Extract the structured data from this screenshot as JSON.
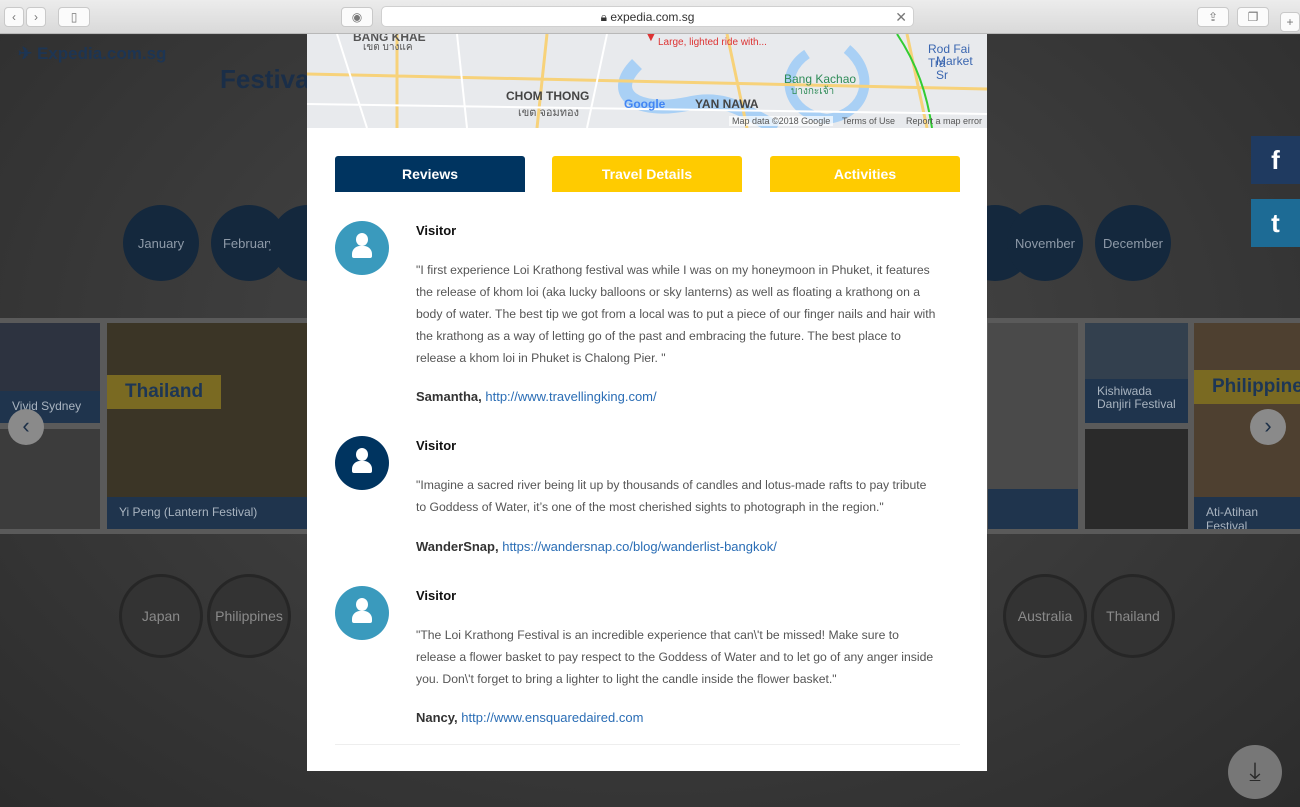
{
  "browser": {
    "url": "expedia.com.sg",
    "back": "‹",
    "forward": "›"
  },
  "site": {
    "logo": "Expedia.com.sg",
    "title": "Festiva"
  },
  "months": [
    "January",
    "February",
    "November",
    "December"
  ],
  "countries": [
    "Japan",
    "Philippines",
    "Australia",
    "Thailand"
  ],
  "gallery": {
    "tiles": [
      {
        "caption": "Vivid Sydney"
      },
      {
        "caption": "Yi Peng (Lantern Festival)",
        "tag": "Thailand"
      },
      {
        "caption": "Kishiwada Danjiri Festival"
      },
      {
        "caption": "Ati-Atihan Festival",
        "tag": "Philippine"
      }
    ]
  },
  "social": {
    "facebook": "f",
    "twitter": "t"
  },
  "map": {
    "labels": [
      "BANG KHAE",
      "เขต บางแค",
      "CHOM THONG",
      "เขต จอมทอง",
      "YAN NAWA",
      "Bang Kachao",
      "บางกะเจ้า",
      "Rod Fai Tra",
      "Market Sr",
      "Large, lighted ride with..."
    ],
    "attribution": "Map data ©2018 Google",
    "terms": "Terms of Use",
    "report": "Report a map error",
    "google": "Google"
  },
  "tabs": [
    {
      "label": "Reviews",
      "active": true,
      "color": "#003460"
    },
    {
      "label": "Travel Details",
      "color": "#ffcb00"
    },
    {
      "label": "Activities",
      "color": "#ffcb00"
    }
  ],
  "reviews": [
    {
      "role": "Visitor",
      "avatar_color": "#3a9abd",
      "text": "\"I first experience Loi Krathong festival was while I was on my honeymoon in Phuket, it features the release of khom loi (aka lucky balloons or sky lanterns) as well as floating a krathong  on a body of water. The best tip we got from a local was to put a piece of our finger nails and hair with the krathong as a way of letting go of the past and embracing the future. The best place to release a khom loi in Phuket is Chalong Pier.  \"",
      "author": "Samantha,",
      "link": "http://www.travellingking.com/"
    },
    {
      "role": "Visitor",
      "avatar_color": "#003460",
      "text": "\"Imagine a sacred river being lit up by thousands of candles and lotus-made rafts to pay tribute to Goddess of Water, it’s one of the most cherished sights to photograph in the region.\"",
      "author": "WanderSnap,",
      "link": "https://wandersnap.co/blog/wanderlist-bangkok/"
    },
    {
      "role": "Visitor",
      "avatar_color": "#3a9abd",
      "text": "\"The Loi Krathong Festival is an incredible experience that can\\'t be missed! Make sure to release a flower basket to pay respect to the Goddess of Water and to let go of any anger inside you. Don\\'t forget to bring a lighter to light the candle inside the flower basket.\"",
      "author": "Nancy,",
      "link": "http://www.ensquaredaired.com"
    }
  ]
}
